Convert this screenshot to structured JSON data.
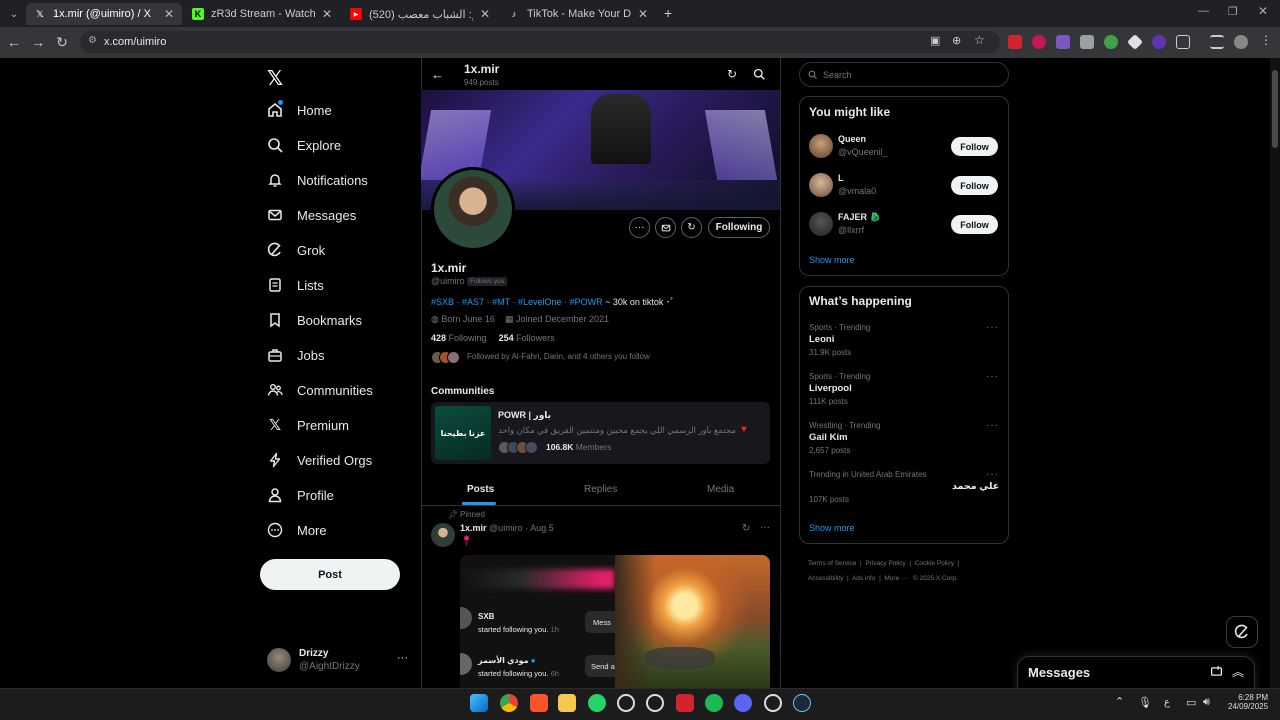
{
  "browser": {
    "tabs": [
      {
        "title": "1x.mir (@uimiro) / X",
        "icon": "x-logo-icon"
      },
      {
        "title": "zR3d Stream - Watch Live on Ki",
        "icon": "kick-icon"
      },
      {
        "title": "(520) بيجي ستيم: الشباب معصب",
        "icon": "youtube-icon"
      },
      {
        "title": "TikTok - Make Your Day",
        "icon": "tiktok-icon"
      }
    ],
    "url": "x.com/uimiro"
  },
  "nav": {
    "items": [
      {
        "label": "Home",
        "icon": "home-icon"
      },
      {
        "label": "Explore",
        "icon": "search-icon"
      },
      {
        "label": "Notifications",
        "icon": "bell-icon"
      },
      {
        "label": "Messages",
        "icon": "mail-icon"
      },
      {
        "label": "Grok",
        "icon": "grok-icon"
      },
      {
        "label": "Lists",
        "icon": "list-icon"
      },
      {
        "label": "Bookmarks",
        "icon": "bookmark-icon"
      },
      {
        "label": "Jobs",
        "icon": "briefcase-icon"
      },
      {
        "label": "Communities",
        "icon": "people-icon"
      },
      {
        "label": "Premium",
        "icon": "x-logo-icon"
      },
      {
        "label": "Verified Orgs",
        "icon": "lightning-icon"
      },
      {
        "label": "Profile",
        "icon": "person-icon"
      },
      {
        "label": "More",
        "icon": "more-circle-icon"
      }
    ],
    "post_label": "Post",
    "account": {
      "name": "Drizzy",
      "handle": "@AightDrizzy"
    }
  },
  "profile": {
    "header_name": "1x.mir",
    "post_count": "949 posts",
    "name": "1x.mir",
    "handle": "@uimiro",
    "follows_you": "Follows you",
    "bio_tags": [
      "#SXB",
      "#AS7",
      "#MT",
      "#LevelOne",
      "#POWR"
    ],
    "bio_rest": "~ 30k on tiktok ･ﾟ",
    "born": "Born June 16",
    "joined": "Joined December 2021",
    "following_count": "428",
    "following_label": "Following",
    "followers_count": "254",
    "followers_label": "Followers",
    "followed_by": "Followed by Al-Fahri, Darin, and 4 others you follow",
    "following_button": "Following"
  },
  "communities": {
    "heading": "Communities",
    "name": "POWR | باور",
    "description": "مجتمع باور الرسمي اللي يجمع محبين ومنتمين الفريق في مكان واحد",
    "members_count": "106.8K",
    "members_label": "Members",
    "thumb_text": "عزنا بطيحنا"
  },
  "tabs": {
    "posts": "Posts",
    "replies": "Replies",
    "media": "Media"
  },
  "pinned_post": {
    "pinned_label": "Pinned",
    "author": "1x.mir",
    "handle": "@uimiro",
    "date": "· Aug 5",
    "notif1_name": "SXB",
    "notif1_text": "started following you.",
    "notif1_time": "1h",
    "notif2_name": "مودي الأسمر",
    "notif2_text": "started following you.",
    "notif2_time": "6h",
    "msg_label": "Mess",
    "send_label": "Send a"
  },
  "right": {
    "search_placeholder": "Search",
    "might_like_title": "You might like",
    "suggestions": [
      {
        "name": "Queen",
        "handle": "@vQueenil_",
        "button": "Follow"
      },
      {
        "name": "L",
        "handle": "@vmala0",
        "button": "Follow"
      },
      {
        "name": "FAJER",
        "handle": "@llxrrf",
        "button": "Follow"
      }
    ],
    "show_more": "Show more",
    "happening_title": "What’s happening",
    "trends": [
      {
        "context": "Sports · Trending",
        "name": "Leoni",
        "posts": "31.9K posts"
      },
      {
        "context": "Sports · Trending",
        "name": "Liverpool",
        "posts": "111K posts"
      },
      {
        "context": "Wrestling · Trending",
        "name": "Gail Kim",
        "posts": "2,657 posts"
      },
      {
        "context": "Trending in United Arab Emirates",
        "name": "علي محمد",
        "posts": "107K posts"
      }
    ],
    "show_more_2": "Show more",
    "footer": [
      "Terms of Service",
      "Privacy Policy",
      "Cookie Policy",
      "Accessibility",
      "Ads info",
      "More ···",
      "© 2025 X Corp."
    ]
  },
  "messages_drawer": {
    "title": "Messages"
  },
  "taskbar": {
    "lang": "ع",
    "time": "6:28 PM",
    "date": "24/09/2025"
  },
  "colors": {
    "accent": "#1d9bf0",
    "bg": "#000000",
    "border": "#2f3336",
    "muted": "#71767b"
  }
}
